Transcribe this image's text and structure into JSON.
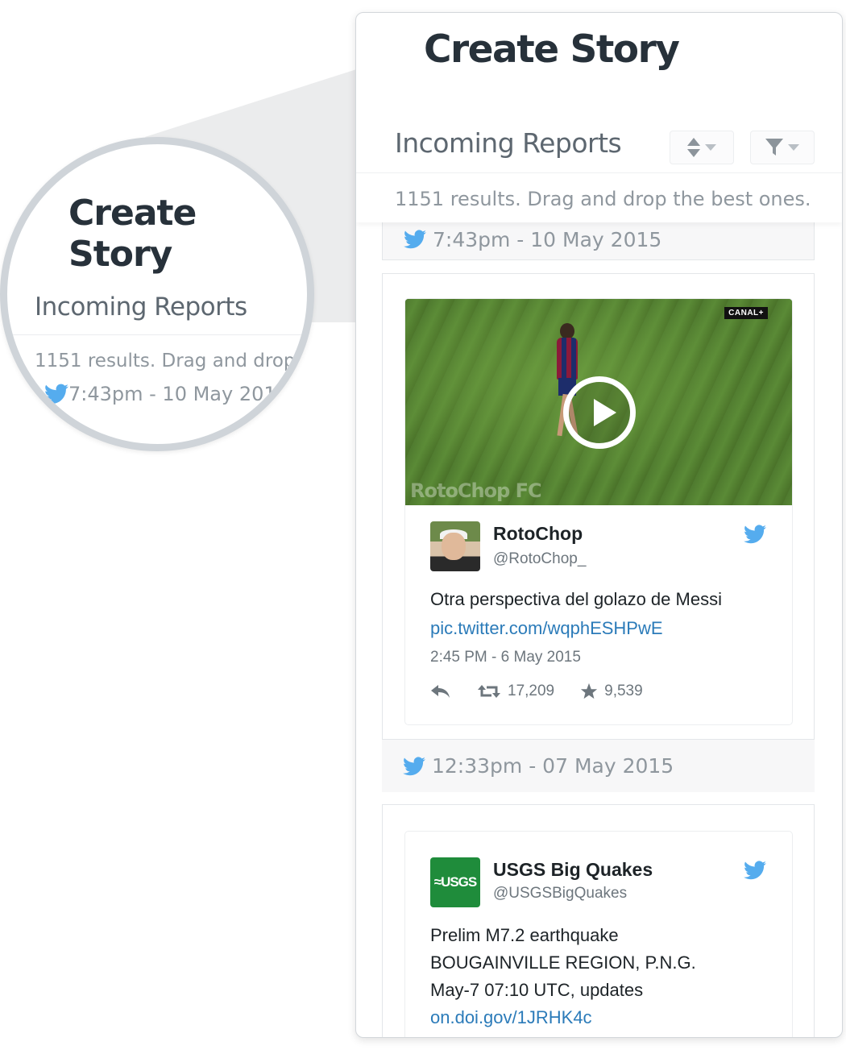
{
  "zoom_callout": {
    "title": "Create Story",
    "section_heading": "Incoming Reports",
    "results_text": "1151 results. Drag and drop",
    "date_text": "7:43pm - 10 May 2015"
  },
  "panel": {
    "title": "Create Story",
    "section_heading": "Incoming Reports",
    "results_text": "1151 results. Drag and drop the best ones.",
    "sort_icon": "sort-icon",
    "filter_icon": "filter-icon"
  },
  "reports": [
    {
      "date_text": "7:43pm - 10 May 2015"
    },
    {
      "media": {
        "channel_badge": "CANAL+",
        "watermark": "RotoChop FC"
      },
      "tweet": {
        "display_name": "RotoChop",
        "handle": "@RotoChop_",
        "text_lines": [
          "Otra perspectiva del golazo de Messi"
        ],
        "link": "pic.twitter.com/wqphESHPwE",
        "time": "2:45 PM - 6 May 2015",
        "retweets": "17,209",
        "favorites": "9,539"
      },
      "date_text": "12:33pm - 07 May 2015"
    },
    {
      "tweet": {
        "display_name": "USGS Big Quakes",
        "handle": "@USGSBigQuakes",
        "avatar_text": "≈USGS",
        "text_lines": [
          "Prelim M7.2 earthquake",
          "BOUGAINVILLE REGION, P.N.G.",
          "May-7 07:10 UTC, updates"
        ],
        "link": "on.doi.gov/1JRHK4c"
      }
    }
  ],
  "colors": {
    "twitter_blue": "#55acee",
    "link_blue": "#2b7bb9",
    "heading": "#27313a",
    "muted": "#8f979e",
    "usgs_green": "#1f8c3b"
  }
}
